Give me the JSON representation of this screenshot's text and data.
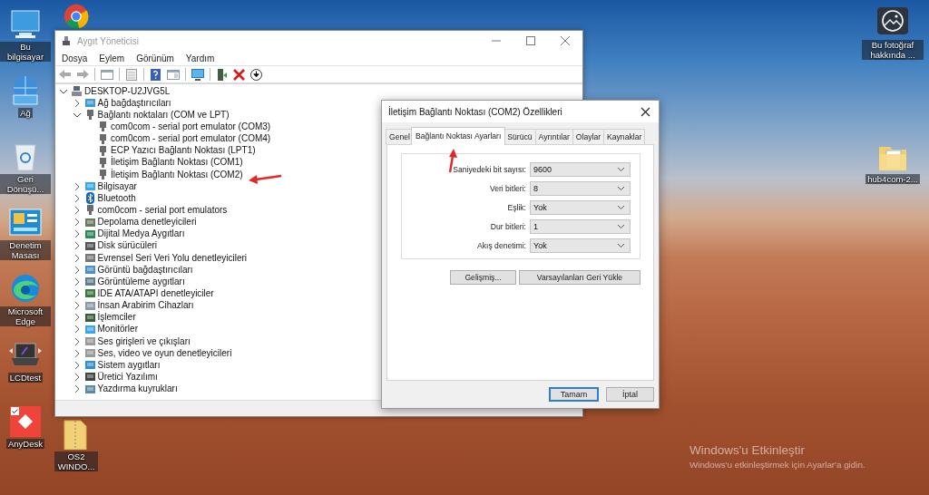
{
  "desktop": {
    "left_icons": [
      {
        "kind": "computer",
        "label": "Bu bilgisayar"
      },
      {
        "kind": "network",
        "label": "Ağ"
      },
      {
        "kind": "recycle",
        "label": "Geri Dönüşü..."
      },
      {
        "kind": "control-panel",
        "label": "Denetim Masası"
      },
      {
        "kind": "edge",
        "label": "Microsoft Edge"
      },
      {
        "kind": "lcdtest",
        "label": "LCDtest"
      },
      {
        "kind": "anydesk",
        "label": "AnyDesk"
      }
    ],
    "second_icons": [
      {
        "kind": "chrome"
      },
      {
        "kind": "zip-folder",
        "label": "OS2 WINDO..."
      }
    ],
    "right_icons": [
      {
        "kind": "photo-info",
        "label": "Bu fotoğraf hakkında ..."
      },
      {
        "kind": "folder",
        "label": "hub4com-2..."
      }
    ]
  },
  "device_manager": {
    "title": "Aygıt Yöneticisi",
    "menu": [
      "Dosya",
      "Eylem",
      "Görünüm",
      "Yardım"
    ],
    "toolbar": [
      {
        "kind": "back"
      },
      {
        "kind": "forward"
      },
      {
        "kind": "sep"
      },
      {
        "kind": "console"
      },
      {
        "kind": "sep"
      },
      {
        "kind": "properties"
      },
      {
        "kind": "sep"
      },
      {
        "kind": "help"
      },
      {
        "kind": "panel"
      },
      {
        "kind": "sep"
      },
      {
        "kind": "scan"
      },
      {
        "kind": "sep"
      },
      {
        "kind": "update-driver"
      },
      {
        "kind": "uninstall"
      },
      {
        "kind": "disable"
      }
    ],
    "tree": {
      "label": "DESKTOP-U2JVG5L",
      "kind": "computer",
      "expanded": true,
      "children": [
        {
          "label": "Ağ bağdaştırıcıları",
          "kind": "network",
          "expanded": false
        },
        {
          "label": "Bağlantı noktaları (COM ve LPT)",
          "kind": "port",
          "expanded": true,
          "children": [
            {
              "label": "com0com - serial port emulator (COM3)",
              "kind": "port"
            },
            {
              "label": "com0com - serial port emulator (COM4)",
              "kind": "port"
            },
            {
              "label": "ECP Yazıcı Bağlantı Noktası (LPT1)",
              "kind": "port"
            },
            {
              "label": "İletişim Bağlantı Noktası (COM1)",
              "kind": "port"
            },
            {
              "label": "İletişim Bağlantı Noktası (COM2)",
              "kind": "port"
            }
          ]
        },
        {
          "label": "Bilgisayar",
          "kind": "monitor",
          "expanded": false
        },
        {
          "label": "Bluetooth",
          "kind": "bluetooth",
          "expanded": false
        },
        {
          "label": "com0com - serial port emulators",
          "kind": "port",
          "expanded": false
        },
        {
          "label": "Depolama denetleyicileri",
          "kind": "storage",
          "expanded": false
        },
        {
          "label": "Dijital Medya Aygıtları",
          "kind": "media",
          "expanded": false
        },
        {
          "label": "Disk sürücüleri",
          "kind": "disk",
          "expanded": false
        },
        {
          "label": "Evrensel Seri Veri Yolu denetleyicileri",
          "kind": "usb",
          "expanded": false
        },
        {
          "label": "Görüntü bağdaştırıcıları",
          "kind": "display",
          "expanded": false
        },
        {
          "label": "Görüntüleme aygıtları",
          "kind": "imaging",
          "expanded": false
        },
        {
          "label": "IDE ATA/ATAPI denetleyiciler",
          "kind": "ide",
          "expanded": false
        },
        {
          "label": "İnsan Arabirim Cihazları",
          "kind": "hid",
          "expanded": false
        },
        {
          "label": "İşlemciler",
          "kind": "cpu",
          "expanded": false
        },
        {
          "label": "Monitörler",
          "kind": "monitor",
          "expanded": false
        },
        {
          "label": "Ses girişleri ve çıkışları",
          "kind": "audio",
          "expanded": false
        },
        {
          "label": "Ses, video ve oyun denetleyicileri",
          "kind": "audio",
          "expanded": false
        },
        {
          "label": "Sistem aygıtları",
          "kind": "system",
          "expanded": false
        },
        {
          "label": "Üretici Yazılımı",
          "kind": "firmware",
          "expanded": false
        },
        {
          "label": "Yazdırma kuyrukları",
          "kind": "printer",
          "expanded": false
        }
      ]
    }
  },
  "properties_dialog": {
    "title": "İletişim Bağlantı Noktası (COM2) Özellikleri",
    "tabs": [
      {
        "label": "Genel",
        "selected": false
      },
      {
        "label": "Bağlantı Noktası Ayarları",
        "selected": true
      },
      {
        "label": "Sürücü",
        "selected": false
      },
      {
        "label": "Ayrıntılar",
        "selected": false
      },
      {
        "label": "Olaylar",
        "selected": false
      },
      {
        "label": "Kaynaklar",
        "selected": false
      }
    ],
    "settings": [
      {
        "label": "Saniyedeki bit sayısı:",
        "value": "9600"
      },
      {
        "label": "Veri bitleri:",
        "value": "8"
      },
      {
        "label": "Eşlik:",
        "value": "Yok"
      },
      {
        "label": "Dur bitleri:",
        "value": "1"
      },
      {
        "label": "Akış denetimi:",
        "value": "Yok"
      }
    ],
    "buttons": [
      "Gelişmiş...",
      "Varsayılanları Geri Yükle"
    ],
    "footer_buttons": [
      {
        "label": "Tamam",
        "default": true
      },
      {
        "label": "İptal",
        "default": false
      }
    ]
  },
  "activation": {
    "title": "Windows'u Etkinleştir",
    "message": "Windows'u etkinleştirmek için Ayarlar'a gidin."
  }
}
